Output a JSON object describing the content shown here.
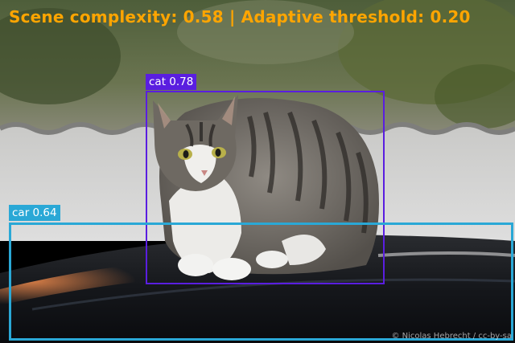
{
  "overlay": {
    "text": "Scene complexity: 0.58 | Adaptive threshold: 0.20",
    "color": "#ffa500"
  },
  "detections": [
    {
      "label": "cat 0.78",
      "color": "#5a1ee0"
    },
    {
      "label": "car 0.64",
      "color": "#2aa8d6"
    }
  ],
  "photo": {
    "credit": "© Nicolas Hebrecht / cc-by-sa"
  }
}
